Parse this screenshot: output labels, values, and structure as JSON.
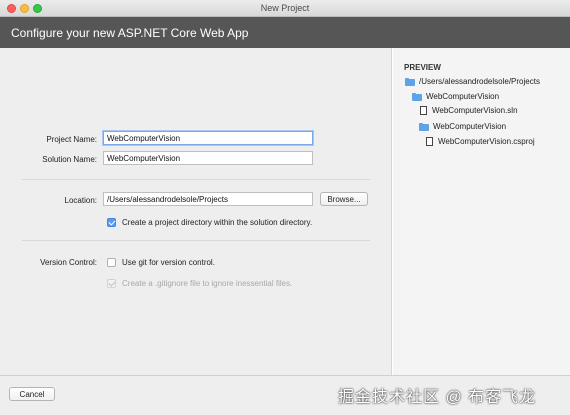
{
  "window": {
    "title": "New Project"
  },
  "header": {
    "title": "Configure your new ASP.NET Core Web App"
  },
  "form": {
    "project_name_label": "Project Name:",
    "project_name_value": "WebComputerVision",
    "solution_name_label": "Solution Name:",
    "solution_name_value": "WebComputerVision",
    "location_label": "Location:",
    "location_value": "/Users/alessandrodelsole/Projects",
    "browse_label": "Browse...",
    "create_dir_label": "Create a project directory within the solution directory.",
    "create_dir_checked": true,
    "version_control_label": "Version Control:",
    "use_git_label": "Use git for version control.",
    "use_git_checked": false,
    "gitignore_label": "Create a .gitignore file to ignore inessential files.",
    "gitignore_checked": true,
    "gitignore_enabled": false
  },
  "preview": {
    "title": "PREVIEW",
    "items": [
      {
        "label": "/Users/alessandrodelsole/Projects",
        "icon": "folder-icon"
      },
      {
        "label": "WebComputerVision",
        "icon": "folder-icon"
      },
      {
        "label": "WebComputerVision.sln",
        "icon": "file-icon"
      },
      {
        "label": "WebComputerVision",
        "icon": "folder-icon"
      },
      {
        "label": "WebComputerVision.csproj",
        "icon": "file-icon"
      }
    ]
  },
  "footer": {
    "cancel_label": "Cancel",
    "watermark": "掘金技术社区 @ 布客飞龙"
  },
  "colors": {
    "header_bg": "#565656",
    "accent": "#5b9bf0",
    "folder": "#5ea2e8"
  }
}
